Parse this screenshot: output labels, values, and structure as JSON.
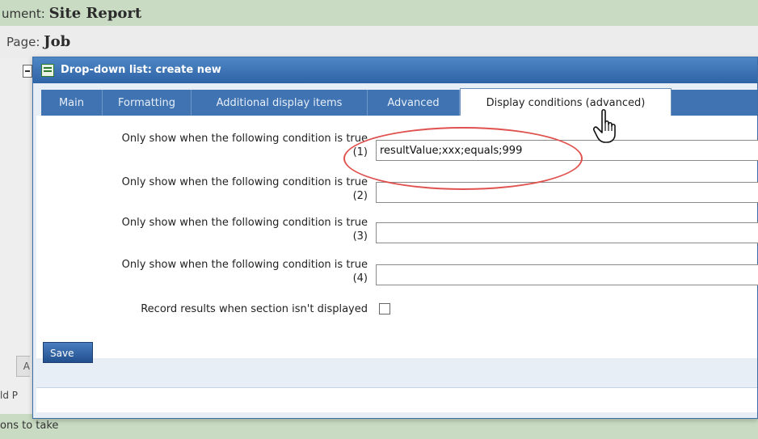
{
  "background": {
    "document_prefix": "ument: ",
    "document_name": "Site Report",
    "page_prefix": "Page: ",
    "page_name": "Job",
    "partial_button": "A",
    "partial_add": "ld P",
    "partial_actions": "ons to take"
  },
  "dialog": {
    "title": "Drop-down list: create new",
    "icon": "list-form-icon",
    "tabs": [
      {
        "label": "Main"
      },
      {
        "label": "Formatting"
      },
      {
        "label": "Additional display items"
      },
      {
        "label": "Advanced"
      },
      {
        "label": "Display conditions (advanced)",
        "active": true
      }
    ],
    "conditions": [
      {
        "label": "Only show when the following condition is true",
        "number": "(1)",
        "value": "resultValue;xxx;equals;999"
      },
      {
        "label": "Only show when the following condition is true",
        "number": "(2)",
        "value": ""
      },
      {
        "label": "Only show when the following condition is true",
        "number": "(3)",
        "value": ""
      },
      {
        "label": "Only show when the following condition is true",
        "number": "(4)",
        "value": ""
      }
    ],
    "record_results_label": "Record results when section isn't displayed",
    "record_results_checked": false,
    "save_label": "Save"
  },
  "colors": {
    "titlebar": "#3a6eae",
    "tab_bar": "#3f73b2",
    "annotation": "#e0524f",
    "header_band": "#c9dcc3"
  },
  "cursor_icon": "hand-pointer-icon"
}
